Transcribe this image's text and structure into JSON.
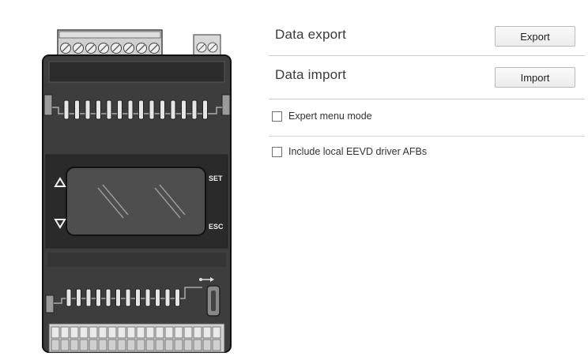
{
  "export": {
    "title": "Data export",
    "button_label": "Export"
  },
  "import": {
    "title": "Data import",
    "button_label": "Import"
  },
  "options": {
    "expert_menu_label": "Expert menu mode",
    "expert_menu_checked": false,
    "include_eevd_label": "Include local EEVD driver AFBs",
    "include_eevd_checked": false
  },
  "device": {
    "set_label": "SET",
    "esc_label": "ESC",
    "up_icon": "triangle-up-icon",
    "down_icon": "triangle-down-icon",
    "usb_icon": "usb-icon"
  }
}
